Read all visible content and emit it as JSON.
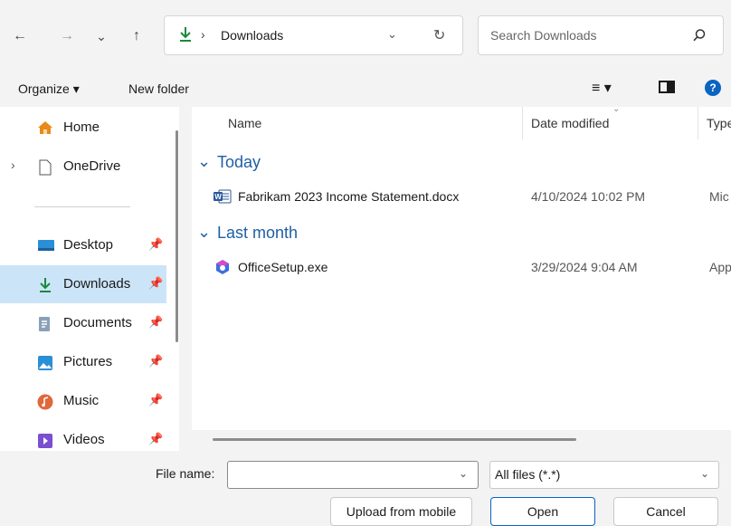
{
  "nav": {
    "back": "←",
    "forward": "→",
    "recent": "⌄",
    "up": "↑"
  },
  "address": {
    "path": "Downloads",
    "separator": "›"
  },
  "search": {
    "placeholder": "Search Downloads"
  },
  "commands": {
    "organize": "Organize ▾",
    "new_folder": "New folder"
  },
  "sidebar": {
    "items": [
      {
        "label": "Home",
        "icon": "home-icon",
        "pinned": false
      },
      {
        "label": "OneDrive",
        "icon": "document-outline-icon",
        "pinned": false
      },
      {
        "label": "Desktop",
        "icon": "desktop-icon",
        "pinned": true
      },
      {
        "label": "Downloads",
        "icon": "download-icon",
        "pinned": true,
        "selected": true
      },
      {
        "label": "Documents",
        "icon": "documents-icon",
        "pinned": true
      },
      {
        "label": "Pictures",
        "icon": "pictures-icon",
        "pinned": true
      },
      {
        "label": "Music",
        "icon": "music-icon",
        "pinned": true
      },
      {
        "label": "Videos",
        "icon": "videos-icon",
        "pinned": true
      }
    ]
  },
  "columns": {
    "name": "Name",
    "date": "Date modified",
    "type": "Type"
  },
  "groups": [
    {
      "label": "Today",
      "files": [
        {
          "name": "Fabrikam 2023 Income Statement.docx",
          "date": "4/10/2024 10:02 PM",
          "type": "Mic",
          "icon": "word-icon"
        }
      ]
    },
    {
      "label": "Last month",
      "files": [
        {
          "name": "OfficeSetup.exe",
          "date": "3/29/2024 9:04 AM",
          "type": "App",
          "icon": "office-icon"
        }
      ]
    }
  ],
  "footer": {
    "file_name_label": "File name:",
    "file_name_value": "",
    "filter": "All files (*.*)",
    "upload": "Upload from mobile",
    "open": "Open",
    "cancel": "Cancel"
  },
  "colors": {
    "accent": "#0a64c2",
    "selected": "#cce4f7",
    "group": "#1f5fa6"
  }
}
